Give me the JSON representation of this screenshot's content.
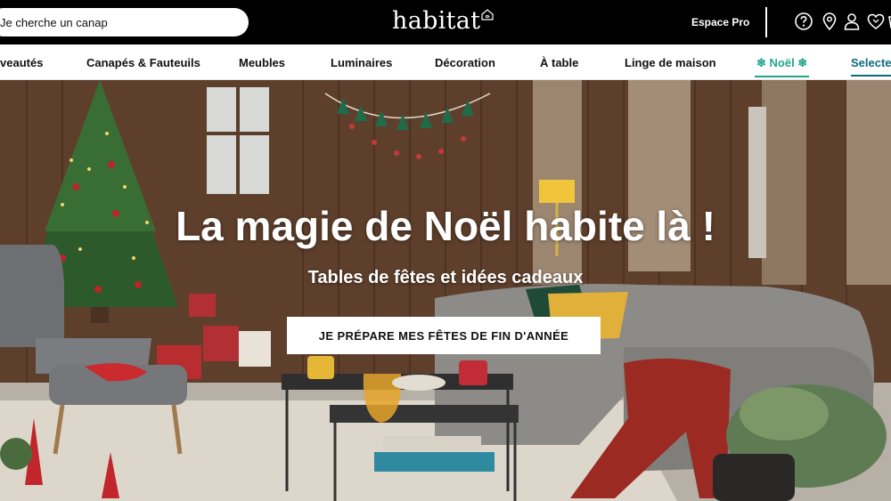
{
  "header": {
    "search_placeholder": "Je cherche un canap",
    "logo_text": "habitat",
    "espace_pro": "Espace Pro",
    "icons": [
      "help-icon",
      "store-locator-icon",
      "account-icon",
      "wishlist-icon",
      "cart-icon"
    ]
  },
  "nav": {
    "items": [
      {
        "label": "veautés"
      },
      {
        "label": "Canapés & Fauteuils"
      },
      {
        "label": "Meubles"
      },
      {
        "label": "Luminaires"
      },
      {
        "label": "Décoration"
      },
      {
        "label": "À table"
      },
      {
        "label": "Linge de maison"
      },
      {
        "label": "❄ Noël ❄"
      },
      {
        "label": "Selected"
      }
    ]
  },
  "hero": {
    "title": "La magie de Noël habite là !",
    "subtitle": "Tables de fêtes et idées cadeaux",
    "cta_label": "JE PRÉPARE MES FÊTES DE FIN D'ANNÉE"
  },
  "colors": {
    "accent_noel": "#1fa88a",
    "accent_selected": "#0c6b7c",
    "header_bg": "#000000"
  }
}
